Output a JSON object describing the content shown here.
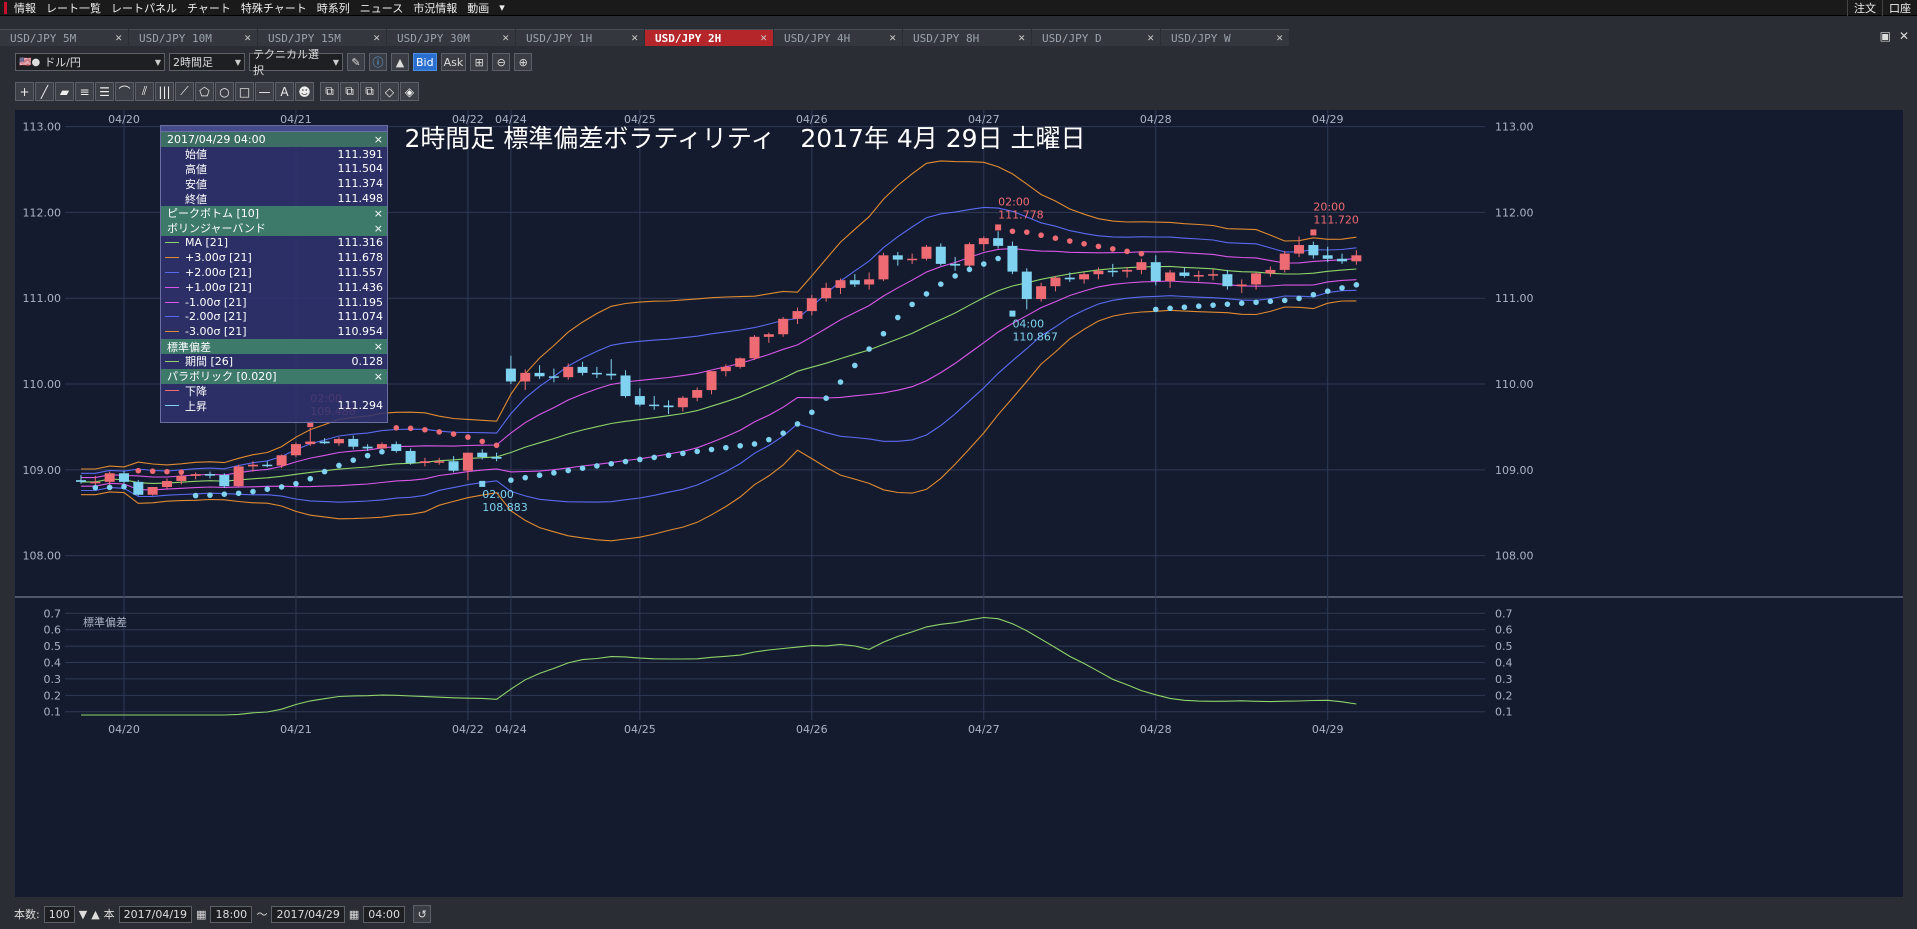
{
  "menu": [
    "情報",
    "レート一覧",
    "レートパネル",
    "チャート",
    "特殊チャート",
    "時系列",
    "ニュース",
    "市況情報",
    "動画"
  ],
  "menu_more": "▾",
  "menu_right": [
    "注文",
    "口座"
  ],
  "tabs": [
    {
      "label": "USD/JPY 5M",
      "active": false
    },
    {
      "label": "USD/JPY 10M",
      "active": false
    },
    {
      "label": "USD/JPY 15M",
      "active": false
    },
    {
      "label": "USD/JPY 30M",
      "active": false
    },
    {
      "label": "USD/JPY 1H",
      "active": false
    },
    {
      "label": "USD/JPY 2H",
      "active": true
    },
    {
      "label": "USD/JPY 4H",
      "active": false
    },
    {
      "label": "USD/JPY 8H",
      "active": false
    },
    {
      "label": "USD/JPY D",
      "active": false
    },
    {
      "label": "USD/JPY W",
      "active": false
    }
  ],
  "toolbar": {
    "pair": "ドル/円",
    "timeframe": "2時間足",
    "technical": "テクニカル選択",
    "bid": "Bid",
    "ask": "Ask"
  },
  "drawing_tools": [
    "crosshair",
    "line",
    "ruler",
    "hlines",
    "hlines2",
    "fan",
    "pitchfork",
    "vlines",
    "fib",
    "pentagon",
    "circle",
    "rectangle",
    "hline",
    "text",
    "icon",
    "copy1",
    "copy2",
    "copy3",
    "eraser",
    "erase-all"
  ],
  "chart": {
    "title": "2時間足 標準偏差ボラティリティ　2017年 4月 29日 土曜日",
    "y_ticks": [
      "113.00",
      "112.00",
      "111.00",
      "110.00",
      "109.00",
      "108.00"
    ],
    "y_tick_values": [
      113,
      112,
      111,
      110,
      109,
      108
    ],
    "sub_ticks": [
      "0.7",
      "0.6",
      "0.5",
      "0.4",
      "0.3",
      "0.2",
      "0.1"
    ],
    "sub_tick_values": [
      0.7,
      0.6,
      0.5,
      0.4,
      0.3,
      0.2,
      0.1
    ],
    "sub_label": "標準偏差",
    "date_labels": [
      "04/20",
      "04/21",
      "04/22",
      "04/24",
      "04/25",
      "04/26",
      "04/27",
      "04/28",
      "04/29"
    ],
    "date_label_bars": [
      3,
      15,
      27,
      30,
      39,
      51,
      63,
      75,
      87
    ],
    "annotations": [
      {
        "time": "02:00",
        "value": "109.486",
        "bar": 16,
        "price": 109.486,
        "kind": "high"
      },
      {
        "time": "02:00",
        "value": "108.883",
        "bar": 28,
        "price": 108.883,
        "kind": "low"
      },
      {
        "time": "02:00",
        "value": "111.778",
        "bar": 64,
        "price": 111.778,
        "kind": "high"
      },
      {
        "time": "04:00",
        "value": "110.867",
        "bar": 65,
        "price": 110.867,
        "kind": "low"
      },
      {
        "time": "20:00",
        "value": "111.720",
        "bar": 86,
        "price": 111.72,
        "kind": "high"
      }
    ],
    "colors": {
      "up": "#ef6b73",
      "down": "#7fd3f0",
      "ma": "#8fd46a",
      "s1": "#d957e8",
      "s2": "#5a6af0",
      "s3": "#e08a30",
      "sar_down": "#ef6b73",
      "sar_up": "#7fd3f0",
      "std": "#8fd46a",
      "bg": "#141b2e"
    }
  },
  "chart_data": {
    "type": "candlestick",
    "series": [
      {
        "name": "USD/JPY 2時間足",
        "ohlc": [
          [
            108.88,
            108.94,
            108.84,
            108.86
          ],
          [
            108.86,
            108.93,
            108.8,
            108.86
          ],
          [
            108.86,
            108.98,
            108.82,
            108.96
          ],
          [
            108.96,
            108.99,
            108.84,
            108.86
          ],
          [
            108.86,
            108.88,
            108.7,
            108.71
          ],
          [
            108.71,
            108.8,
            108.7,
            108.8
          ],
          [
            108.8,
            108.9,
            108.78,
            108.87
          ],
          [
            108.87,
            108.97,
            108.83,
            108.93
          ],
          [
            108.93,
            108.97,
            108.89,
            108.95
          ],
          [
            108.95,
            108.98,
            108.9,
            108.94
          ],
          [
            108.94,
            108.96,
            108.79,
            108.81
          ],
          [
            108.81,
            109.06,
            108.8,
            109.04
          ],
          [
            109.04,
            109.1,
            108.98,
            109.06
          ],
          [
            109.06,
            109.1,
            109.03,
            109.05
          ],
          [
            109.05,
            109.18,
            109.02,
            109.17
          ],
          [
            109.17,
            109.32,
            109.15,
            109.3
          ],
          [
            109.3,
            109.49,
            109.28,
            109.33
          ],
          [
            109.33,
            109.37,
            109.3,
            109.31
          ],
          [
            109.31,
            109.38,
            109.28,
            109.36
          ],
          [
            109.36,
            109.4,
            109.24,
            109.27
          ],
          [
            109.27,
            109.3,
            109.22,
            109.25
          ],
          [
            109.25,
            109.32,
            109.22,
            109.3
          ],
          [
            109.3,
            109.33,
            109.2,
            109.22
          ],
          [
            109.22,
            109.25,
            109.06,
            109.08
          ],
          [
            109.08,
            109.14,
            109.04,
            109.1
          ],
          [
            109.1,
            109.14,
            109.06,
            109.1
          ],
          [
            109.1,
            109.16,
            108.97,
            108.99
          ],
          [
            108.99,
            109.2,
            108.88,
            109.2
          ],
          [
            109.2,
            109.24,
            109.12,
            109.15
          ],
          [
            109.15,
            109.2,
            109.1,
            109.13
          ],
          [
            110.18,
            110.33,
            110.0,
            110.03
          ],
          [
            110.03,
            110.17,
            109.93,
            110.13
          ],
          [
            110.13,
            110.22,
            110.06,
            110.09
          ],
          [
            110.09,
            110.18,
            110.02,
            110.08
          ],
          [
            110.08,
            110.24,
            110.05,
            110.2
          ],
          [
            110.2,
            110.26,
            110.1,
            110.13
          ],
          [
            110.13,
            110.2,
            110.07,
            110.12
          ],
          [
            110.12,
            110.29,
            110.05,
            110.1
          ],
          [
            110.1,
            110.16,
            109.84,
            109.86
          ],
          [
            109.86,
            109.95,
            109.74,
            109.76
          ],
          [
            109.76,
            109.86,
            109.7,
            109.75
          ],
          [
            109.75,
            109.81,
            109.65,
            109.73
          ],
          [
            109.73,
            109.86,
            109.68,
            109.84
          ],
          [
            109.84,
            109.96,
            109.8,
            109.93
          ],
          [
            109.93,
            110.15,
            109.88,
            110.15
          ],
          [
            110.15,
            110.23,
            110.09,
            110.2
          ],
          [
            110.2,
            110.31,
            110.18,
            110.3
          ],
          [
            110.3,
            110.57,
            110.28,
            110.55
          ],
          [
            110.55,
            110.6,
            110.48,
            110.58
          ],
          [
            110.58,
            110.78,
            110.55,
            110.76
          ],
          [
            110.76,
            110.89,
            110.7,
            110.85
          ],
          [
            110.85,
            111.04,
            110.8,
            111.0
          ],
          [
            111.0,
            111.18,
            110.96,
            111.12
          ],
          [
            111.12,
            111.23,
            111.05,
            111.21
          ],
          [
            111.21,
            111.28,
            111.13,
            111.16
          ],
          [
            111.16,
            111.3,
            111.1,
            111.22
          ],
          [
            111.22,
            111.53,
            111.2,
            111.5
          ],
          [
            111.5,
            111.54,
            111.38,
            111.45
          ],
          [
            111.45,
            111.52,
            111.4,
            111.46
          ],
          [
            111.46,
            111.62,
            111.44,
            111.6
          ],
          [
            111.6,
            111.64,
            111.38,
            111.4
          ],
          [
            111.4,
            111.48,
            111.32,
            111.38
          ],
          [
            111.38,
            111.65,
            111.35,
            111.63
          ],
          [
            111.63,
            111.72,
            111.55,
            111.7
          ],
          [
            111.7,
            111.78,
            111.58,
            111.61
          ],
          [
            111.61,
            111.66,
            111.28,
            111.31
          ],
          [
            111.31,
            111.35,
            110.87,
            110.99
          ],
          [
            110.99,
            111.18,
            110.96,
            111.14
          ],
          [
            111.14,
            111.26,
            111.08,
            111.24
          ],
          [
            111.24,
            111.3,
            111.19,
            111.22
          ],
          [
            111.22,
            111.3,
            111.17,
            111.28
          ],
          [
            111.28,
            111.36,
            111.22,
            111.32
          ],
          [
            111.32,
            111.4,
            111.25,
            111.31
          ],
          [
            111.31,
            111.36,
            111.24,
            111.33
          ],
          [
            111.33,
            111.46,
            111.28,
            111.42
          ],
          [
            111.42,
            111.5,
            111.15,
            111.2
          ],
          [
            111.2,
            111.33,
            111.12,
            111.3
          ],
          [
            111.3,
            111.36,
            111.24,
            111.26
          ],
          [
            111.26,
            111.32,
            111.2,
            111.27
          ],
          [
            111.27,
            111.34,
            111.21,
            111.28
          ],
          [
            111.28,
            111.33,
            111.1,
            111.14
          ],
          [
            111.14,
            111.22,
            111.06,
            111.16
          ],
          [
            111.16,
            111.3,
            111.1,
            111.29
          ],
          [
            111.29,
            111.37,
            111.25,
            111.33
          ],
          [
            111.33,
            111.55,
            111.3,
            111.52
          ],
          [
            111.52,
            111.72,
            111.48,
            111.62
          ],
          [
            111.62,
            111.66,
            111.46,
            111.5
          ],
          [
            111.5,
            111.6,
            111.42,
            111.46
          ],
          [
            111.46,
            111.52,
            111.4,
            111.43
          ],
          [
            111.43,
            111.56,
            111.39,
            111.5
          ]
        ]
      }
    ],
    "x_range": [
      "04/19 18:00",
      "04/29 04:00"
    ],
    "y_range": [
      107.6,
      113.1
    ],
    "sub_range": [
      0.08,
      0.72
    ]
  },
  "indicator_panel": {
    "datetime": "2017/04/29 04:00",
    "ohlc": [
      {
        "label": "始値",
        "value": "111.391"
      },
      {
        "label": "高値",
        "value": "111.504"
      },
      {
        "label": "安値",
        "value": "111.374"
      },
      {
        "label": "終値",
        "value": "111.498"
      }
    ],
    "peak_bottom": "ピークボトム [10]",
    "bollinger": "ボリンジャーバンド",
    "bb_rows": [
      {
        "label": "MA [21]",
        "value": "111.316",
        "color": "#8fd46a"
      },
      {
        "label": "+3.00σ [21]",
        "value": "111.678",
        "color": "#e08a30"
      },
      {
        "label": "+2.00σ [21]",
        "value": "111.557",
        "color": "#5a6af0"
      },
      {
        "label": "+1.00σ [21]",
        "value": "111.436",
        "color": "#d957e8"
      },
      {
        "label": "-1.00σ [21]",
        "value": "111.195",
        "color": "#d957e8"
      },
      {
        "label": "-2.00σ [21]",
        "value": "111.074",
        "color": "#5a6af0"
      },
      {
        "label": "-3.00σ [21]",
        "value": "110.954",
        "color": "#e08a30"
      }
    ],
    "stddev": "標準偏差",
    "stddev_row": {
      "label": "期間 [26]",
      "value": "0.128",
      "color": "#8fd46a"
    },
    "parabolic": "パラボリック [0.020]",
    "sar_rows": [
      {
        "label": "下降",
        "value": "",
        "color": "#ef6b73"
      },
      {
        "label": "上昇",
        "value": "111.294",
        "color": "#7fd3f0"
      }
    ],
    "close_glyph": "×"
  },
  "status": {
    "count_label": "本数:",
    "count": "100",
    "unit": "本",
    "from_date": "2017/04/19",
    "from_time": "18:00",
    "tilde": "〜",
    "to_date": "2017/04/29",
    "to_time": "04:00"
  }
}
